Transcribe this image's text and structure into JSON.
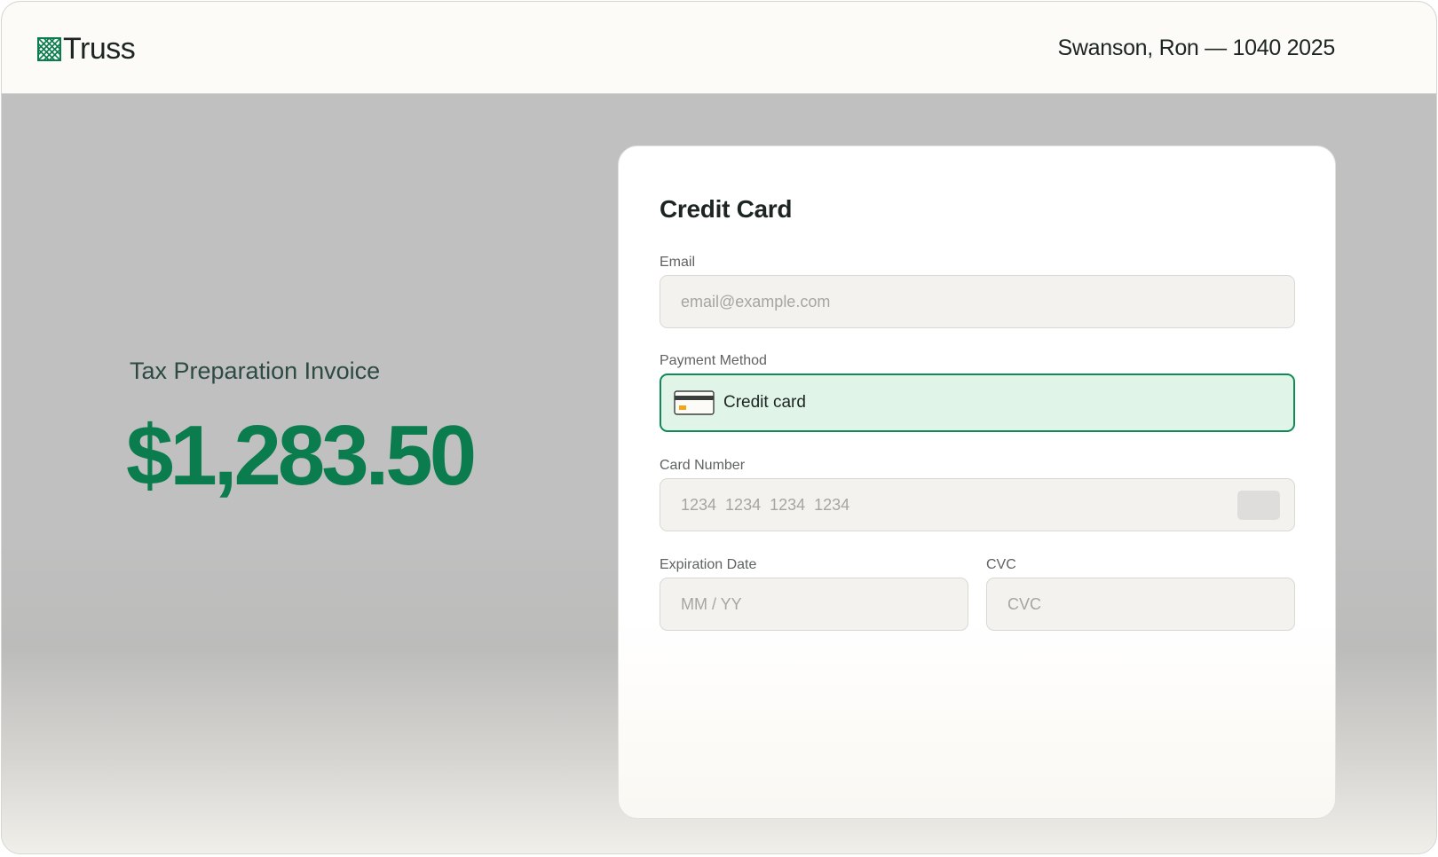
{
  "header": {
    "brand": "Truss",
    "client_title": "Swanson, Ron — 1040 2025"
  },
  "invoice": {
    "label": "Tax Preparation Invoice",
    "amount": "$1,283.50"
  },
  "payment_form": {
    "title": "Credit Card",
    "email": {
      "label": "Email",
      "placeholder": "email@example.com",
      "value": ""
    },
    "payment_method": {
      "label": "Payment Method",
      "selected": "Credit card"
    },
    "card_number": {
      "label": "Card Number",
      "placeholder": "1234  1234  1234  1234",
      "value": ""
    },
    "expiration": {
      "label": "Expiration Date",
      "placeholder": "MM / YY",
      "value": ""
    },
    "cvc": {
      "label": "CVC",
      "placeholder": "CVC",
      "value": ""
    }
  },
  "colors": {
    "brand_green": "#0a7c4e",
    "selected_bg": "#e0f4e8",
    "selected_border": "#0f8a57",
    "card_stripe_accent": "#f2a516"
  },
  "icons": {
    "logo": "truss-lattice-icon",
    "payment_method": "credit-card-icon"
  }
}
